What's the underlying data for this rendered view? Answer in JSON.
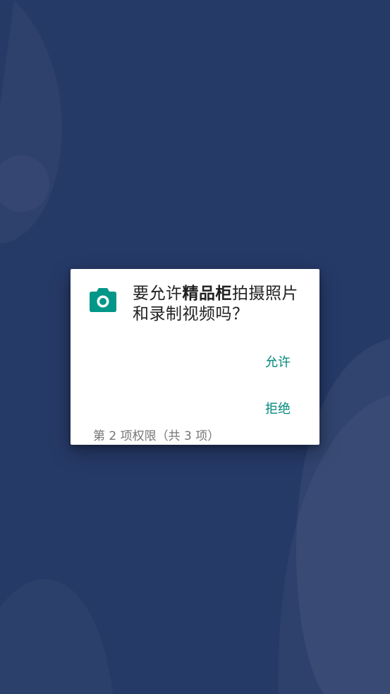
{
  "dialog": {
    "icon": "camera-icon",
    "message_prefix": "要允许",
    "app_name": "精品柜",
    "message_suffix": "拍摄照片和录制视频吗？",
    "allow_label": "允许",
    "deny_label": "拒绝",
    "counter": "第 2 项权限（共 3 项）"
  },
  "colors": {
    "background": "#263a68",
    "accent": "#00897b",
    "icon": "#009688",
    "message_text": "#212121",
    "counter_text": "#757575"
  }
}
